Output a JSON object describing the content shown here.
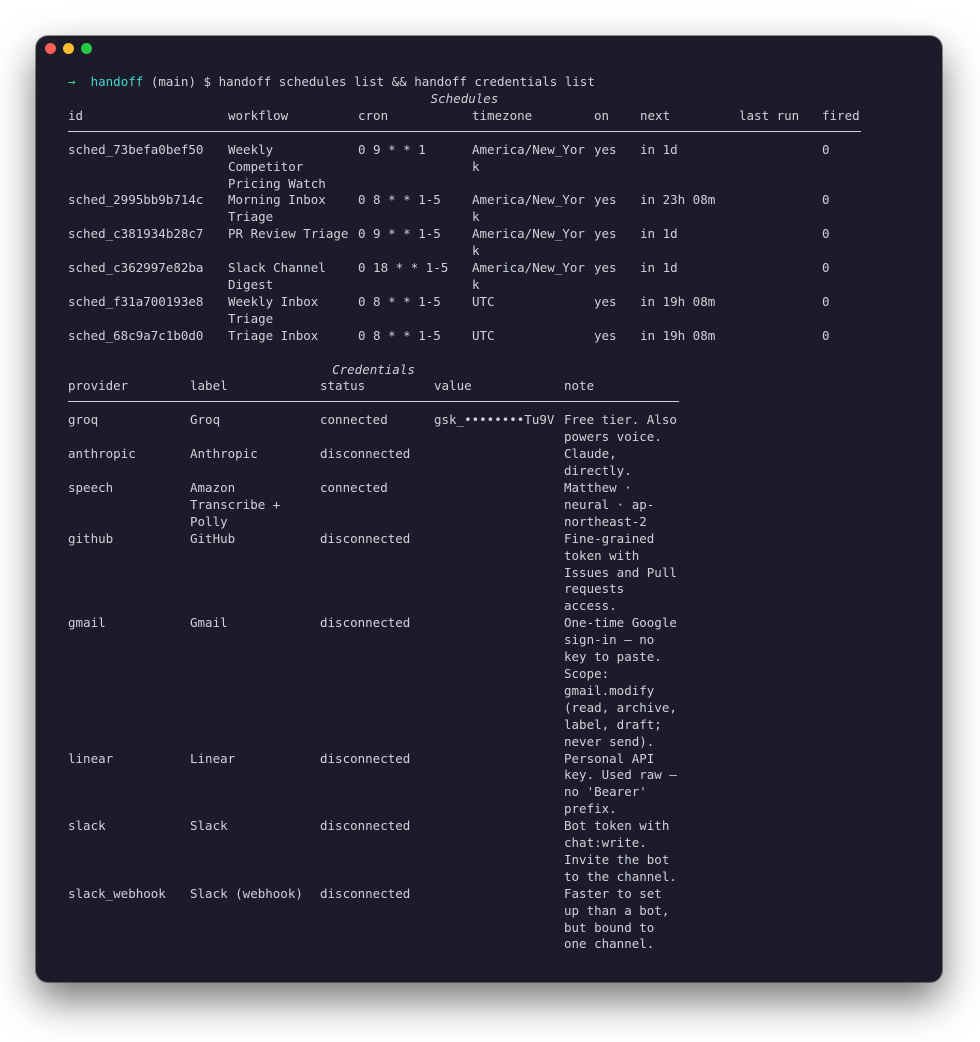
{
  "terminal": {
    "prompt_arrow": "→",
    "prompt_name": "handoff",
    "prompt_branch": "(main)",
    "prompt_symbol": "$",
    "command": "handoff schedules list && handoff credentials list"
  },
  "schedules": {
    "title": "Schedules",
    "headers": [
      "id",
      "workflow",
      "cron",
      "timezone",
      "on",
      "next",
      "last run",
      "fired"
    ],
    "rows": [
      [
        "sched_73befa0bef50",
        "Weekly Competitor Pricing Watch",
        "0 9 * * 1",
        "America/New_York",
        "yes",
        "in 1d",
        "",
        "0"
      ],
      [
        "sched_2995bb9b714c",
        "Morning Inbox Triage",
        "0 8 * * 1-5",
        "America/New_York",
        "yes",
        "in 23h 08m",
        "",
        "0"
      ],
      [
        "sched_c381934b28c7",
        "PR Review Triage",
        "0 9 * * 1-5",
        "America/New_York",
        "yes",
        "in 1d",
        "",
        "0"
      ],
      [
        "sched_c362997e82ba",
        "Slack Channel Digest",
        "0 18 * * 1-5",
        "America/New_York",
        "yes",
        "in 1d",
        "",
        "0"
      ],
      [
        "sched_f31a700193e8",
        "Weekly Inbox Triage",
        "0 8 * * 1-5",
        "UTC",
        "yes",
        "in 19h 08m",
        "",
        "0"
      ],
      [
        "sched_68c9a7c1b0d0",
        "Triage Inbox",
        "0 8 * * 1-5",
        "UTC",
        "yes",
        "in 19h 08m",
        "",
        "0"
      ]
    ]
  },
  "credentials": {
    "title": "Credentials",
    "headers": [
      "provider",
      "label",
      "status",
      "value",
      "note"
    ],
    "rows": [
      [
        "groq",
        "Groq",
        "connected",
        "gsk_••••••••Tu9V",
        "Free tier. Also powers voice."
      ],
      [
        "anthropic",
        "Anthropic",
        "disconnected",
        "",
        "Claude, directly."
      ],
      [
        "speech",
        "Amazon Transcribe + Polly",
        "connected",
        "",
        "Matthew · neural · ap-northeast-2"
      ],
      [
        "github",
        "GitHub",
        "disconnected",
        "",
        "Fine-grained token with Issues and Pull requests access."
      ],
      [
        "gmail",
        "Gmail",
        "disconnected",
        "",
        "One-time Google sign-in — no key to paste. Scope: gmail.modify (read, archive, label, draft; never send)."
      ],
      [
        "linear",
        "Linear",
        "disconnected",
        "",
        "Personal API key. Used raw — no 'Bearer' prefix."
      ],
      [
        "slack",
        "Slack",
        "disconnected",
        "",
        "Bot token with chat:write. Invite the bot to the channel."
      ],
      [
        "slack_webhook",
        "Slack (webhook)",
        "disconnected",
        "",
        "Faster to set up than a bot, but bound to one channel."
      ]
    ]
  }
}
